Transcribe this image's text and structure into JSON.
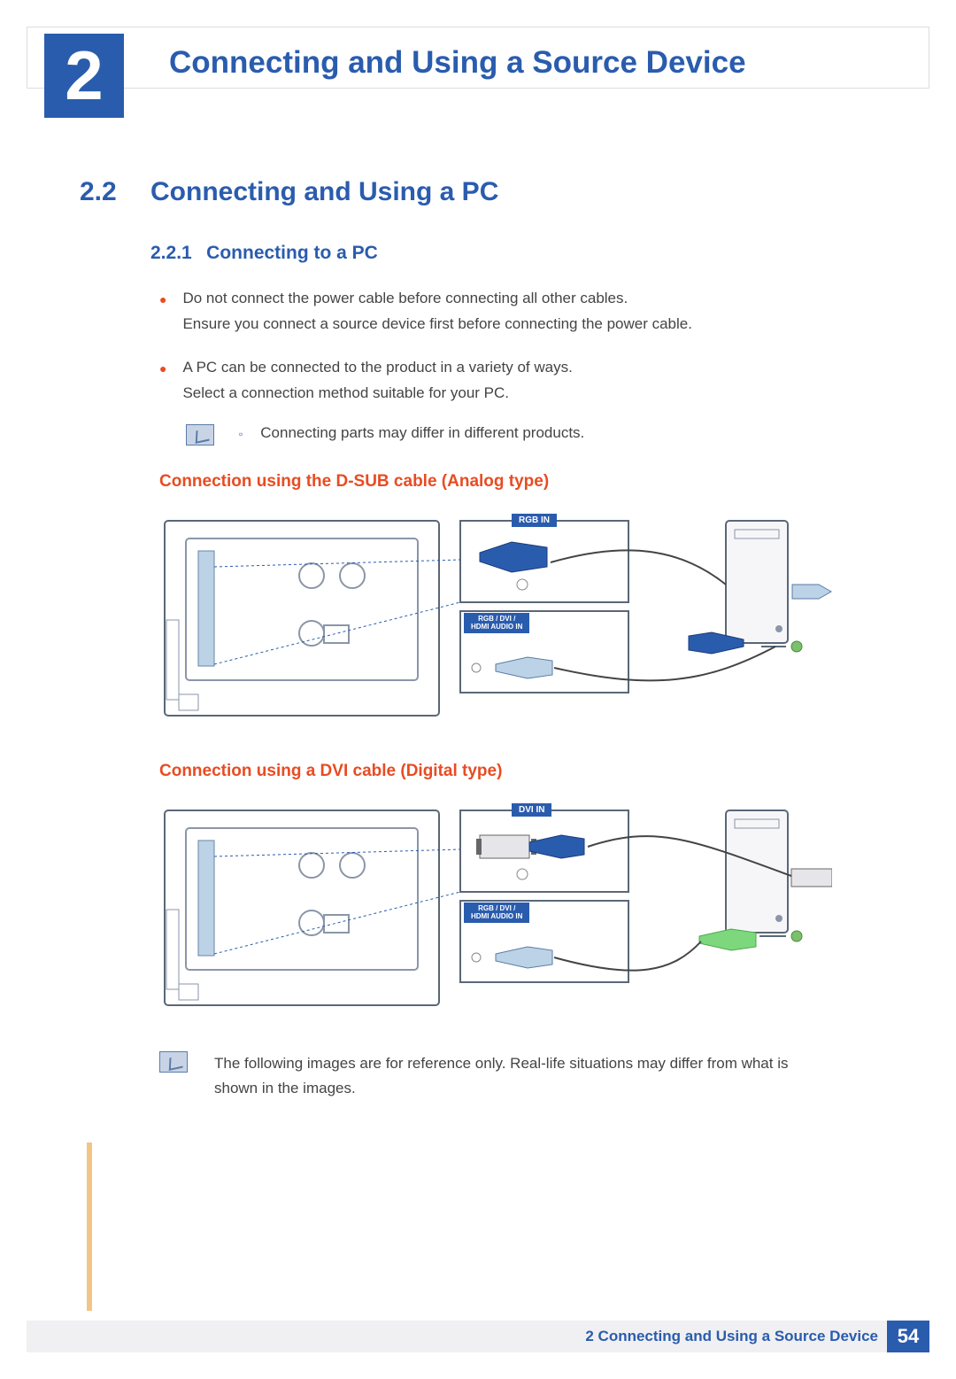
{
  "chapter": {
    "number": "2",
    "title": "Connecting and Using a Source Device"
  },
  "section": {
    "number": "2.2",
    "title": "Connecting and Using a PC"
  },
  "subsection": {
    "number": "2.2.1",
    "title": "Connecting to a PC"
  },
  "bullets": [
    {
      "line1": "Do not connect the power cable before connecting all other cables.",
      "line2": "Ensure you connect a source device first before connecting the power cable."
    },
    {
      "line1": "A PC can be connected to the product in a variety of ways.",
      "line2": "Select a connection method suitable for your PC."
    }
  ],
  "note1": "Connecting parts may differ in different products.",
  "connection1": {
    "heading": "Connection using the D-SUB cable (Analog type)",
    "port_main": "RGB IN",
    "port_audio": "RGB / DVI /\nHDMI AUDIO IN"
  },
  "connection2": {
    "heading": "Connection using a DVI cable (Digital type)",
    "port_main": "DVI IN",
    "port_audio": "RGB / DVI /\nHDMI AUDIO IN"
  },
  "bottom_note": "The following images are for reference only. Real-life situations may differ from what is shown in the images.",
  "footer": {
    "label": "2 Connecting and Using a Source Device",
    "page": "54"
  }
}
